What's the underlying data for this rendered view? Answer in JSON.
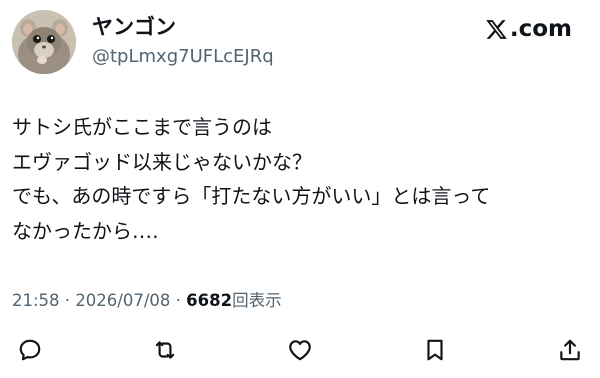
{
  "user": {
    "display_name": "ヤンゴン",
    "handle": "@tpLmxg7UFLcEJRq"
  },
  "brand": {
    "text": ".com",
    "icon": "x-logo-icon"
  },
  "tweet": {
    "lines": [
      "サトシ氏がここまで言うのは",
      "エヴァゴッド以来じゃないかな？",
      "でも、あの時ですら「打たない方がいい」とは言って",
      "なかったから‥‥"
    ]
  },
  "meta": {
    "time": "21:58",
    "separator": " · ",
    "date": "2026/07/08",
    "view_count": "6682",
    "views_label": "回表示"
  },
  "actions": {
    "reply_icon": "reply-icon",
    "retweet_icon": "retweet-icon",
    "like_icon": "heart-icon",
    "bookmark_icon": "bookmark-icon",
    "share_icon": "share-icon"
  },
  "colors": {
    "text": "#0f1419",
    "secondary": "#536471",
    "background": "#ffffff"
  }
}
